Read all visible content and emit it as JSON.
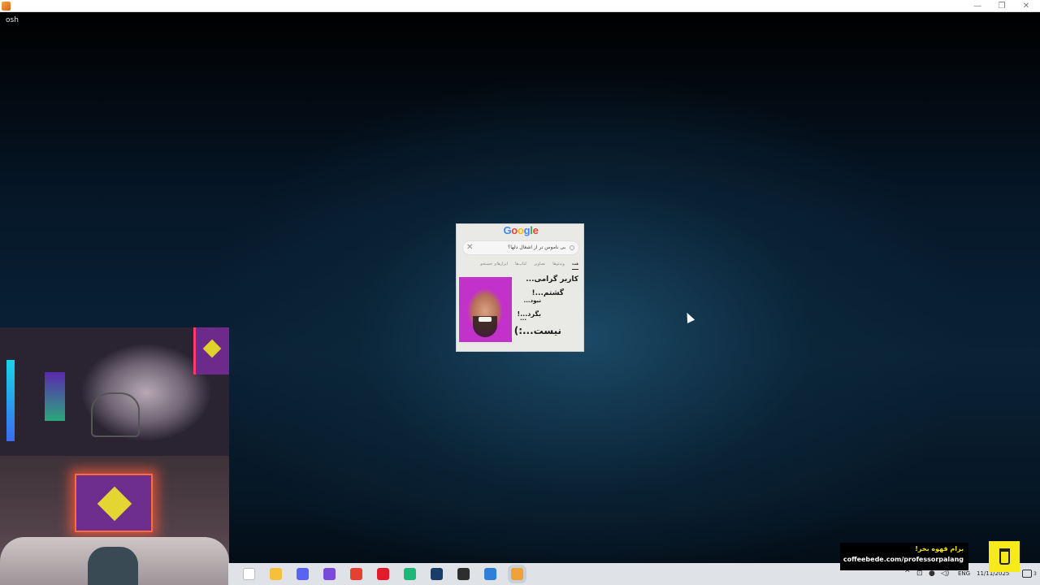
{
  "window": {
    "title_label": "osh",
    "controls": {
      "minimize": "—",
      "restore": "❐",
      "close": "✕"
    }
  },
  "meme": {
    "google_logo": [
      "G",
      "o",
      "o",
      "g",
      "l",
      "e"
    ],
    "search_text": "بی ناموس تر از اشغال دلها؟",
    "clear_symbol": "✕",
    "tabs": [
      "همه",
      "ویدئوها",
      "تصاویر",
      "کتاب‌ها",
      "ابزارهای جستجو"
    ],
    "lines": [
      "کاربر گرامی...",
      "گشتم...!",
      "نبود...",
      "بگرد...!",
      "...",
      "نیست...:)"
    ]
  },
  "taskbar": {
    "icons": [
      {
        "name": "file-icon",
        "color": "#ffffff"
      },
      {
        "name": "file-explorer-icon",
        "color": "#f5c03a"
      },
      {
        "name": "discord-icon",
        "color": "#5865f2"
      },
      {
        "name": "purple-app-icon",
        "color": "#7a4ad8"
      },
      {
        "name": "chrome-icon",
        "color": "#e34133"
      },
      {
        "name": "opera-icon",
        "color": "#e01c2a"
      },
      {
        "name": "green-app-icon",
        "color": "#1fb67a"
      },
      {
        "name": "steam-icon",
        "color": "#1a3c69"
      },
      {
        "name": "razer-icon",
        "color": "#2e2e2e"
      },
      {
        "name": "photos-icon",
        "color": "#2f7fd8"
      },
      {
        "name": "streaming-app-icon",
        "color": "#f0a23a"
      }
    ],
    "tray": {
      "chevron": "^",
      "language": "ENG",
      "date": "11/11/2025",
      "notification_count": "3"
    }
  },
  "overlay": {
    "coffee_text_fa": "برام قهوه بخر!",
    "coffee_url": "coffeebede.com/professorpalang"
  },
  "colors": {
    "accent_yellow": "#f6ea1a",
    "taskbar_bg": "#dfe3e8"
  }
}
